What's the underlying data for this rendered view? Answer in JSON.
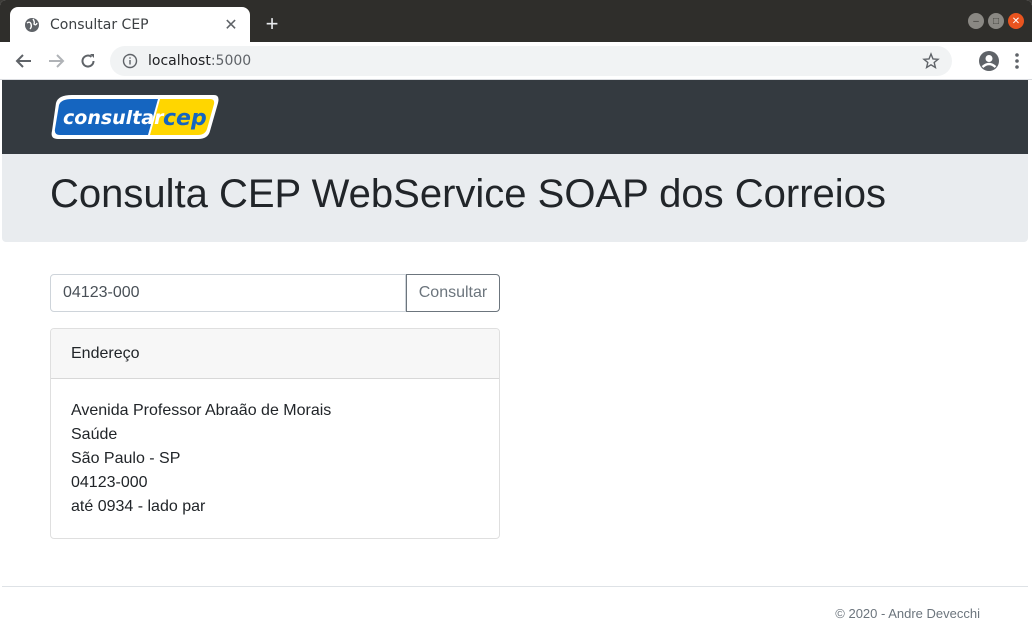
{
  "browser": {
    "tab_title": "Consultar CEP",
    "url_host": "localhost",
    "url_port": ":5000"
  },
  "header": {
    "logo_word1": "consultar",
    "logo_word2": "cep"
  },
  "main": {
    "title": "Consulta CEP WebService SOAP dos Correios",
    "search": {
      "value": "04123-000",
      "button_label": "Consultar"
    },
    "result": {
      "header": "Endereço",
      "lines": [
        "Avenida Professor Abraão de Morais",
        "Saúde",
        "São Paulo - SP",
        "04123-000",
        "até 0934 - lado par"
      ]
    }
  },
  "footer": {
    "copyright": "© 2020 - Andre Devecchi"
  },
  "colors": {
    "navbar": "#343a40",
    "jumbotron": "#e9ecef",
    "logo_blue": "#1565c0",
    "logo_yellow": "#ffd600"
  }
}
